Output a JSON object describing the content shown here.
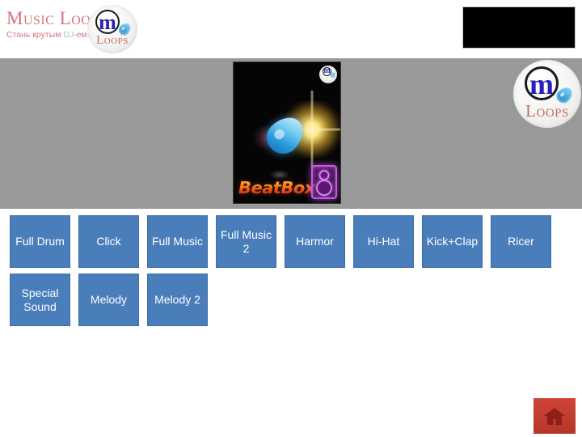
{
  "header": {
    "brand_wordmark": "Music Loops",
    "brand_tagline_pre": "Стань крутым ",
    "brand_tagline_dj": "DJ",
    "brand_tagline_post": "-ем!",
    "logo_letter": "m",
    "logo_word": "Loops",
    "ad_panel_label": ""
  },
  "stage": {
    "album_title": "BeatBox",
    "watermark_letter": "m",
    "badge_letter": "m",
    "badge_word": "Loops",
    "icons": {
      "droplet": "droplet-icon",
      "speaker": "speaker-icon",
      "starburst": "light-burst-icon"
    }
  },
  "pads": {
    "rows": [
      [
        {
          "label": "Full Drum"
        },
        {
          "label": "Click"
        },
        {
          "label": "Full Music"
        },
        {
          "label": "Full Music 2"
        },
        {
          "label": "Harmor"
        },
        {
          "label": "Hi-Hat"
        },
        {
          "label": "Kick+Clap"
        },
        {
          "label": "Ricer"
        }
      ],
      [
        {
          "label": "Special Sound"
        },
        {
          "label": "Melody"
        },
        {
          "label": "Melody 2"
        }
      ]
    ]
  },
  "footer": {
    "home_icon": "home-icon",
    "home_label": ""
  },
  "colors": {
    "pad_fill": "#4a7ebb",
    "pad_border": "#3b6ea6",
    "stage_band": "#999999",
    "brand_pink": "#d4757f",
    "logo_blue": "#2a1fb8",
    "home_red": "#c0392b",
    "ad_panel": "#000000"
  }
}
